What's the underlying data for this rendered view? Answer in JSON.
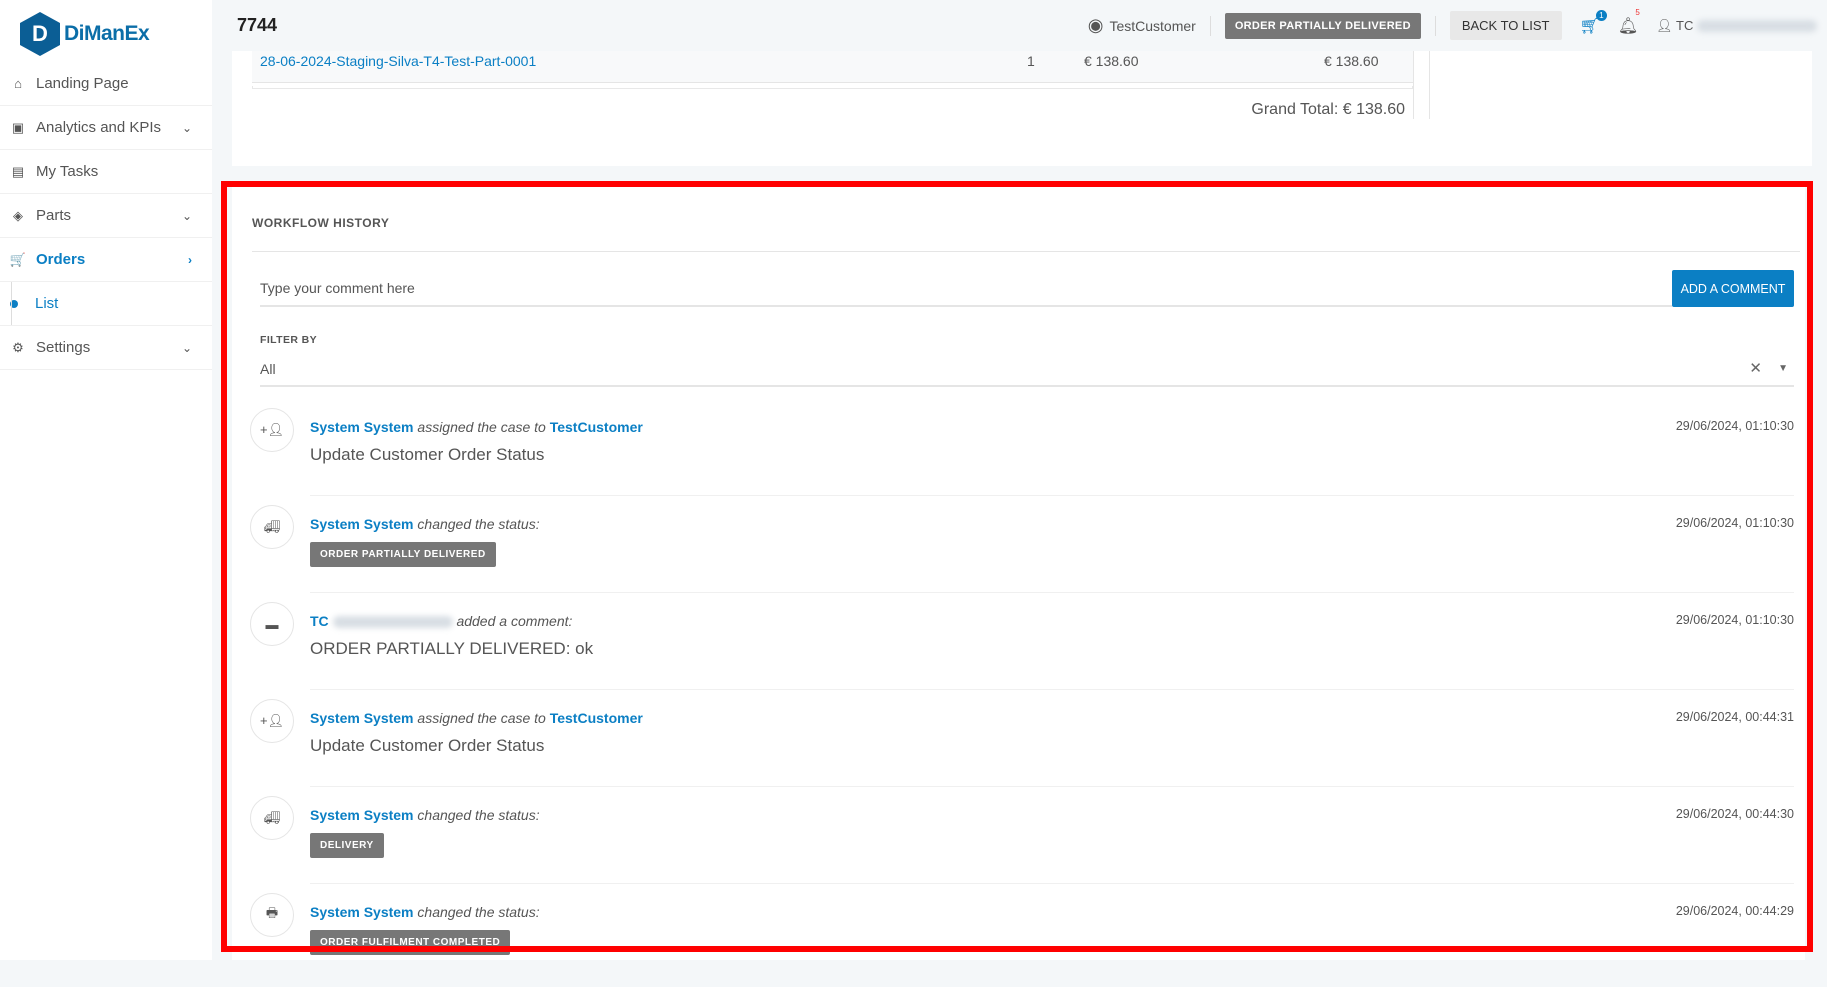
{
  "brand": {
    "logo_letter": "D",
    "name": "DiManEx"
  },
  "sidebar": {
    "items": [
      {
        "label": "Landing Page",
        "icon": "home-icon",
        "glyph": "⌂"
      },
      {
        "label": "Analytics and KPIs",
        "icon": "briefcase-icon",
        "glyph": "▣",
        "chevron": "⌄"
      },
      {
        "label": "My Tasks",
        "icon": "clipboard-icon",
        "glyph": "▤"
      },
      {
        "label": "Parts",
        "icon": "layers-icon",
        "glyph": "◈",
        "chevron": "⌄"
      },
      {
        "label": "Orders",
        "icon": "cart-icon",
        "glyph": "🛒",
        "chevron": "›",
        "active": true
      },
      {
        "label": "List",
        "sub": true
      },
      {
        "label": "Settings",
        "icon": "gear-icon",
        "glyph": "⚙",
        "chevron": "⌄"
      }
    ]
  },
  "header": {
    "title": "7744",
    "user": "TestCustomer",
    "status_button": "ORDER PARTIALLY DELIVERED",
    "back_button": "BACK TO LIST",
    "cart_count": "1",
    "notification_count": "5",
    "account_initials": "TC"
  },
  "order": {
    "line": {
      "part": "28-06-2024-Staging-Silva-T4-Test-Part-0001",
      "qty": "1",
      "unit_price": "€ 138.60",
      "total": "€ 138.60"
    },
    "grand_total": "Grand Total: € 138.60"
  },
  "workflow": {
    "title": "WORKFLOW HISTORY",
    "comment_placeholder": "Type your comment here",
    "add_button": "ADD A COMMENT",
    "filter_label": "FILTER BY",
    "filter_value": "All",
    "entries": [
      {
        "icon": "person-add-icon",
        "actor": "System System",
        "action": "assigned the case to",
        "target": "TestCustomer",
        "detail": "Update Customer Order Status",
        "timestamp": "29/06/2024, 01:10:30"
      },
      {
        "icon": "truck-icon",
        "actor": "System System",
        "action": "changed the status:",
        "status": "ORDER PARTIALLY DELIVERED",
        "timestamp": "29/06/2024, 01:10:30"
      },
      {
        "icon": "comment-icon",
        "actor": "TC",
        "action": "added a comment:",
        "detail": "ORDER PARTIALLY DELIVERED: ok",
        "timestamp": "29/06/2024, 01:10:30"
      },
      {
        "icon": "person-add-icon",
        "actor": "System System",
        "action": "assigned the case to",
        "target": "TestCustomer",
        "detail": "Update Customer Order Status",
        "timestamp": "29/06/2024, 00:44:31"
      },
      {
        "icon": "truck-icon",
        "actor": "System System",
        "action": "changed the status:",
        "status": "DELIVERY",
        "timestamp": "29/06/2024, 00:44:30"
      },
      {
        "icon": "printer-icon",
        "actor": "System System",
        "action": "changed the status:",
        "status": "ORDER FULFILMENT COMPLETED",
        "timestamp": "29/06/2024, 00:44:29"
      }
    ]
  },
  "colors": {
    "accent": "#0b7fc4",
    "status_badge": "#777777",
    "highlight_box": "#ff0000"
  }
}
